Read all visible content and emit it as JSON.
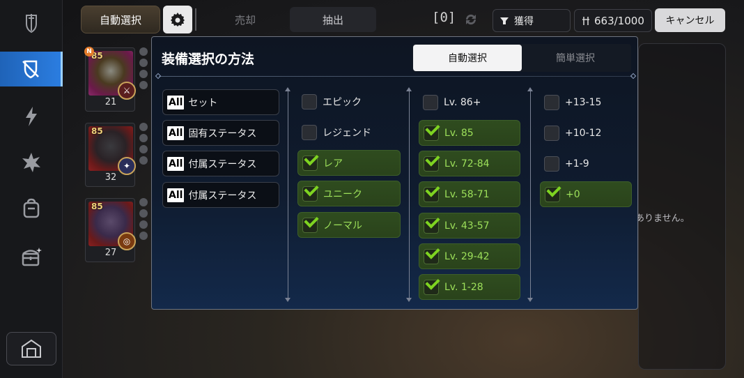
{
  "sidebar": {
    "items": [
      {
        "icon": "sword-shield-icon",
        "active": false
      },
      {
        "icon": "disabled-shield-icon",
        "active": true
      },
      {
        "icon": "lightning-icon",
        "active": false
      },
      {
        "icon": "burst-icon",
        "active": false
      },
      {
        "icon": "backpack-icon",
        "active": false
      },
      {
        "icon": "chest-icon",
        "active": false
      }
    ],
    "bottom_icon": "warehouse-icon"
  },
  "topbar": {
    "auto_select_label": "自動選択",
    "sell_tab": "売却",
    "extract_tab": "抽出",
    "selected_count": "[0]",
    "sort_label": "獲得",
    "capacity": "663/1000",
    "cancel_label": "キャンセル"
  },
  "inventory": [
    {
      "level": "85",
      "count": "21",
      "new_badge": "N"
    },
    {
      "level": "85",
      "count": "32",
      "new_badge": ""
    },
    {
      "level": "85",
      "count": "27",
      "new_badge": ""
    }
  ],
  "empty_message": "ありません。",
  "modal": {
    "title": "装備選択の方法",
    "tab_auto": "自動選択",
    "tab_simple": "簡単選択",
    "stat_filters": [
      {
        "tag": "All",
        "label": "セット"
      },
      {
        "tag": "All",
        "label": "固有ステータス"
      },
      {
        "tag": "All",
        "label": "付属ステータス"
      },
      {
        "tag": "All",
        "label": "付属ステータス"
      }
    ],
    "grade_options": [
      {
        "label": "エピック",
        "checked": false
      },
      {
        "label": "レジェンド",
        "checked": false
      },
      {
        "label": "レア",
        "checked": true
      },
      {
        "label": "ユニーク",
        "checked": true
      },
      {
        "label": "ノーマル",
        "checked": true
      }
    ],
    "level_options": [
      {
        "label": "Lv. 86+",
        "checked": false
      },
      {
        "label": "Lv. 85",
        "checked": true
      },
      {
        "label": "Lv. 72-84",
        "checked": true
      },
      {
        "label": "Lv. 58-71",
        "checked": true
      },
      {
        "label": "Lv. 43-57",
        "checked": true
      },
      {
        "label": "Lv. 29-42",
        "checked": true
      },
      {
        "label": "Lv. 1-28",
        "checked": true
      }
    ],
    "enhance_options": [
      {
        "label": "+13-15",
        "checked": false
      },
      {
        "label": "+10-12",
        "checked": false
      },
      {
        "label": "+1-9",
        "checked": false
      },
      {
        "label": "+0",
        "checked": true
      }
    ]
  },
  "colors": {
    "accent_blue": "#2b7de0",
    "check_green": "#7ed321",
    "checked_bg": "#2f4c1f",
    "modal_bg": "#0f1b2e"
  }
}
